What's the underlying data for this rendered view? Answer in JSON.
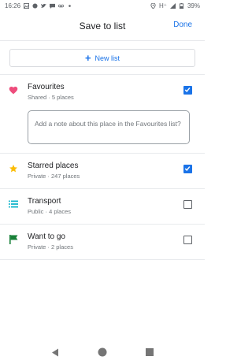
{
  "status_bar": {
    "time": "16:26",
    "network": "H⁺",
    "battery": "39%"
  },
  "header": {
    "title": "Save to list",
    "done_label": "Done"
  },
  "new_list": {
    "label": "New list"
  },
  "lists": [
    {
      "title": "Favourites",
      "subtitle": "Shared · 5 places",
      "icon": "heart-icon",
      "icon_color": "#ee4c7c",
      "checked": true,
      "note_placeholder": "Add a note about this place in the Favourites list?"
    },
    {
      "title": "Starred places",
      "subtitle": "Private · 247 places",
      "icon": "star-icon",
      "icon_color": "#fbbc04",
      "checked": true
    },
    {
      "title": "Transport",
      "subtitle": "Public · 4 places",
      "icon": "list-icon",
      "icon_color": "#12b5cb",
      "checked": false
    },
    {
      "title": "Want to go",
      "subtitle": "Private · 2 places",
      "icon": "flag-icon",
      "icon_color": "#188038",
      "checked": false
    }
  ],
  "colors": {
    "accent": "#1a73e8"
  }
}
